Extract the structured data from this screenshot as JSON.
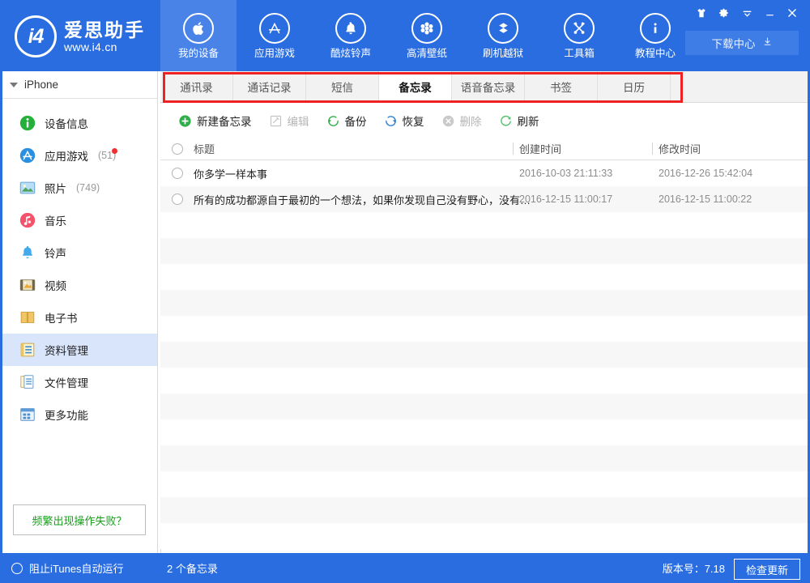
{
  "header": {
    "logo": {
      "mark": "i4",
      "name_cn": "爱思助手",
      "url": "www.i4.cn"
    },
    "nav": [
      {
        "label": "我的设备",
        "icon": "apple-icon",
        "active": true
      },
      {
        "label": "应用游戏",
        "icon": "appstore-icon",
        "active": false
      },
      {
        "label": "酷炫铃声",
        "icon": "bell-icon",
        "active": false
      },
      {
        "label": "高清壁纸",
        "icon": "flower-icon",
        "active": false
      },
      {
        "label": "刷机越狱",
        "icon": "dropbox-icon",
        "active": false
      },
      {
        "label": "工具箱",
        "icon": "tools-icon",
        "active": false
      },
      {
        "label": "教程中心",
        "icon": "info-icon",
        "active": false
      }
    ],
    "window_controls": [
      {
        "name": "skin-icon",
        "title": "换肤"
      },
      {
        "name": "gear-icon",
        "title": "设置"
      },
      {
        "name": "chevron-down-icon",
        "title": "更多"
      },
      {
        "name": "minimize-icon",
        "title": "最小化"
      },
      {
        "name": "close-icon",
        "title": "关闭"
      }
    ],
    "download_center": {
      "label": "下载中心",
      "icon": "download-icon"
    }
  },
  "sidebar": {
    "device": {
      "name": "iPhone",
      "expanded": true
    },
    "items": [
      {
        "label": "设备信息",
        "icon": "info-circle-icon",
        "count": "",
        "badge": false,
        "selected": false
      },
      {
        "label": "应用游戏",
        "icon": "appstore-circle-icon",
        "count": "(51)",
        "badge": true,
        "selected": false
      },
      {
        "label": "照片",
        "icon": "photo-icon",
        "count": "(749)",
        "badge": false,
        "selected": false
      },
      {
        "label": "音乐",
        "icon": "music-icon",
        "count": "",
        "badge": false,
        "selected": false
      },
      {
        "label": "铃声",
        "icon": "ringtone-bell-icon",
        "count": "",
        "badge": false,
        "selected": false
      },
      {
        "label": "视频",
        "icon": "video-icon",
        "count": "",
        "badge": false,
        "selected": false
      },
      {
        "label": "电子书",
        "icon": "book-icon",
        "count": "",
        "badge": false,
        "selected": false
      },
      {
        "label": "资料管理",
        "icon": "data-manage-icon",
        "count": "",
        "badge": false,
        "selected": true
      },
      {
        "label": "文件管理",
        "icon": "file-manage-icon",
        "count": "",
        "badge": false,
        "selected": false
      },
      {
        "label": "更多功能",
        "icon": "more-features-icon",
        "count": "",
        "badge": false,
        "selected": false
      }
    ],
    "help_button": {
      "label": "频繁出现操作失败？",
      "color": "#169e1a"
    }
  },
  "tabs": [
    {
      "label": "通讯录",
      "active": false
    },
    {
      "label": "通话记录",
      "active": false
    },
    {
      "label": "短信",
      "active": false
    },
    {
      "label": "备忘录",
      "active": true
    },
    {
      "label": "语音备忘录",
      "active": false
    },
    {
      "label": "书签",
      "active": false
    },
    {
      "label": "日历",
      "active": false
    }
  ],
  "highlight": {
    "color": "#ee2222"
  },
  "toolbar": [
    {
      "label": "新建备忘录",
      "icon": "plus-circle-icon",
      "enabled": true
    },
    {
      "label": "编辑",
      "icon": "pencil-square-icon",
      "enabled": false
    },
    {
      "label": "备份",
      "icon": "backup-arrow-icon",
      "enabled": true
    },
    {
      "label": "恢复",
      "icon": "restore-arrow-icon",
      "enabled": true
    },
    {
      "label": "删除",
      "icon": "delete-circle-icon",
      "enabled": false
    },
    {
      "label": "刷新",
      "icon": "refresh-icon",
      "enabled": true
    }
  ],
  "table": {
    "columns": [
      {
        "key": "title",
        "label": "标题"
      },
      {
        "key": "created",
        "label": "创建时间"
      },
      {
        "key": "modified",
        "label": "修改时间"
      }
    ],
    "rows": [
      {
        "title": "你多学一样本事",
        "created": "2016-10-03 21:11:33",
        "modified": "2016-12-26 15:42:04"
      },
      {
        "title": "所有的成功都源自于最初的一个想法，如果你发现自己没有野心，没有…",
        "created": "2016-12-15 11:00:17",
        "modified": "2016-12-15 11:00:22"
      }
    ],
    "empty_row_count": 13
  },
  "statusbar": {
    "itunes_toggle": "阻止iTunes自动运行",
    "count_text": "2 个备忘录",
    "version": "版本号：7.18",
    "update_label": "检查更新"
  }
}
